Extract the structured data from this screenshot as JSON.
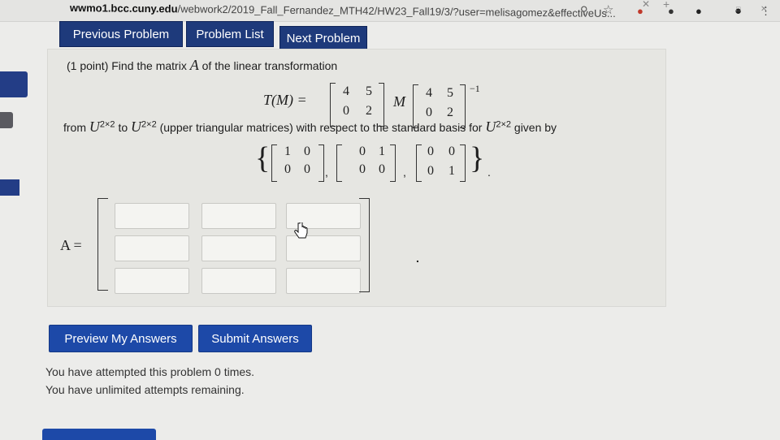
{
  "browser": {
    "url_host": "wwmo1.bcc.cuny.edu",
    "url_path": "/webwork2/2019_Fall_Fernandez_MTH42/HW23_Fall19/3/?user=melisagomez&effectiveUs..."
  },
  "nav": {
    "previous_label": "Previous Problem",
    "list_label": "Problem List",
    "next_label": "Next Problem"
  },
  "problem": {
    "points": "(1 point) Find the matrix",
    "matrix_symbol": "A",
    "points_tail": "of the linear transformation",
    "transform_lhs": "T(M) =",
    "m_symbol": "M",
    "inverse_exp": "−1",
    "mat_a": [
      "4",
      "5",
      "0",
      "2"
    ],
    "mat_b": [
      "4",
      "5",
      "0",
      "2"
    ],
    "from_text": "from",
    "space": "U",
    "dim": "2×2",
    "to_text": "to",
    "desc": "(upper triangular matrices) with respect to the standard basis for",
    "given_by": "given by",
    "basis": [
      [
        "1",
        "0",
        "0",
        "0"
      ],
      [
        "0",
        "1",
        "0",
        "0"
      ],
      [
        "0",
        "0",
        "0",
        "1"
      ]
    ],
    "answer_label": "A ="
  },
  "buttons": {
    "preview_label": "Preview My Answers",
    "submit_label": "Submit Answers"
  },
  "status": {
    "attempts": "You have attempted this problem 0 times.",
    "remaining": "You have unlimited attempts remaining."
  }
}
